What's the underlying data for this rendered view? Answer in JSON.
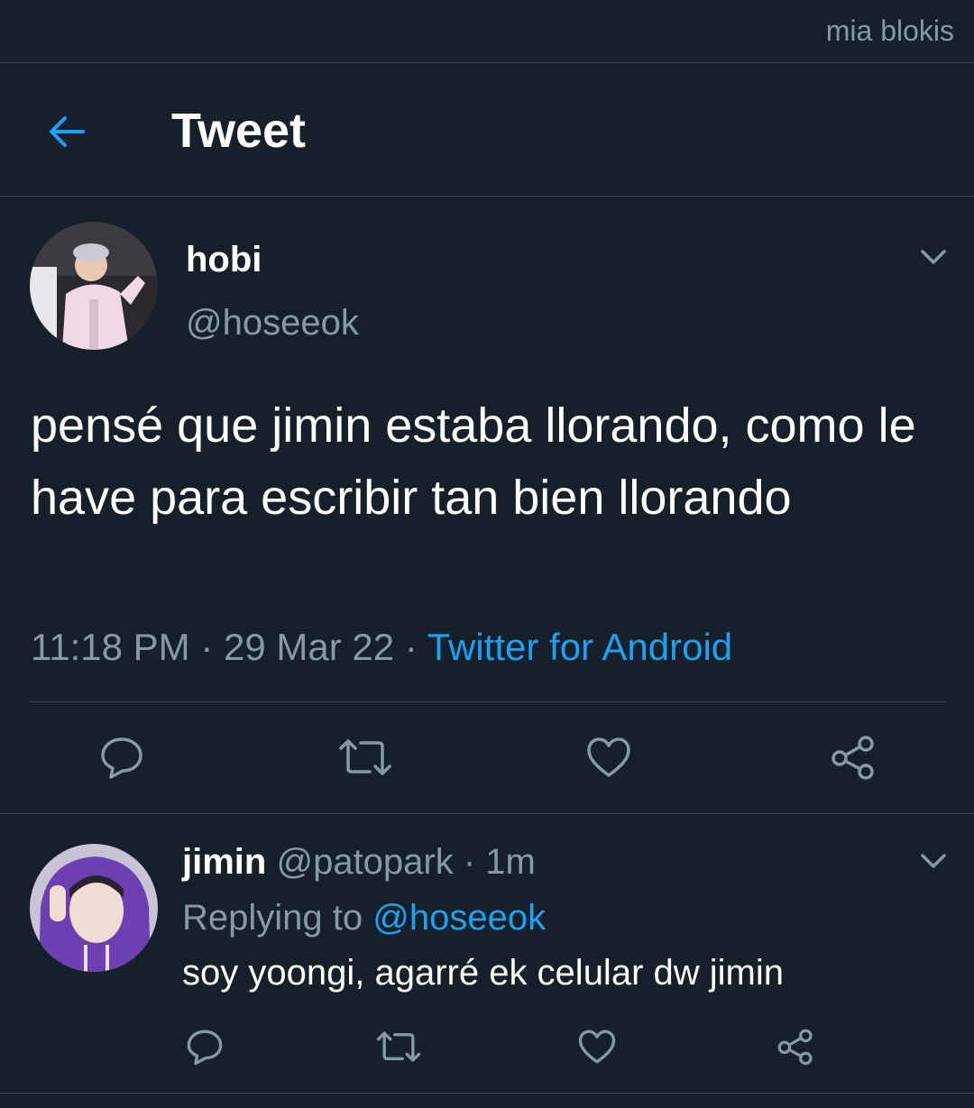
{
  "status_bar": {
    "watermark": "mia blokis"
  },
  "header": {
    "title": "Tweet",
    "back_icon": "arrow-left-icon"
  },
  "tweet": {
    "display_name": "hobi",
    "handle": "@hoseeok",
    "text": "pensé que jimin estaba llorando, como le have para escribir tan bien llorando",
    "time": "11:18 PM",
    "sep1": " · ",
    "date": "29 Mar 22",
    "sep2": " · ",
    "source": "Twitter for Android",
    "actions": [
      "reply-icon",
      "retweet-icon",
      "like-icon",
      "share-icon"
    ]
  },
  "reply": {
    "display_name": "jimin",
    "handle": "@patopark",
    "sep": " · ",
    "age": "1m",
    "replying_prefix": "Replying to ",
    "replying_to": "@hoseeok",
    "text": "soy yoongi, agarré ek celular dw jimin",
    "actions": [
      "reply-icon",
      "retweet-icon",
      "like-icon",
      "share-icon"
    ]
  },
  "colors": {
    "background": "#15202b",
    "muted": "#8899a6",
    "accent": "#1da1f2",
    "divider": "#38444d"
  }
}
